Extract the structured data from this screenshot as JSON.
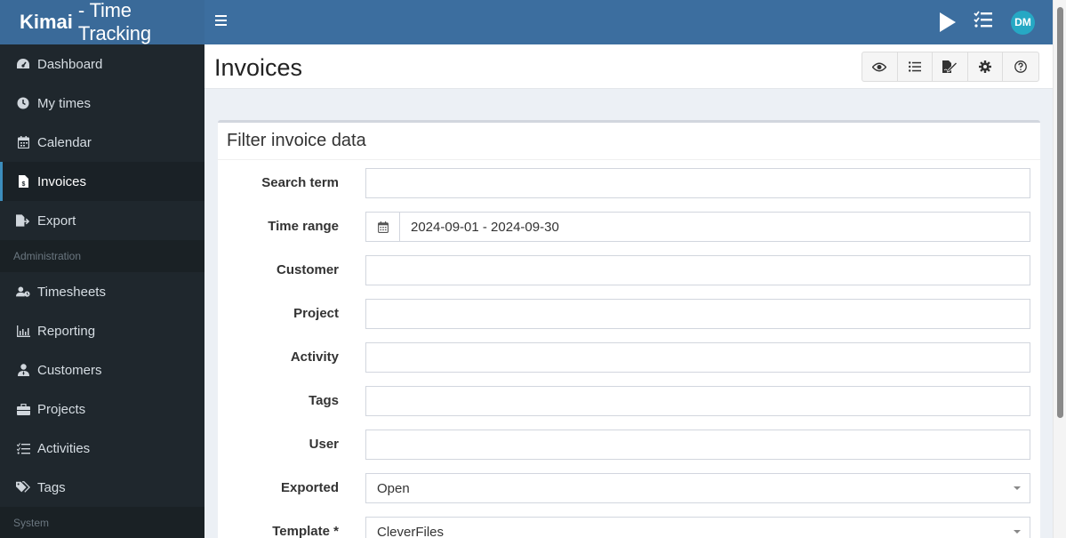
{
  "app": {
    "brand_bold": "Kimai",
    "brand_light": "- Time Tracking",
    "user_initials": "DM",
    "accent_color": "#3c6e9f",
    "avatar_color": "#26a8c4"
  },
  "sidebar": {
    "items": [
      {
        "label": "Dashboard",
        "icon": "dashboard-icon"
      },
      {
        "label": "My times",
        "icon": "clock-icon"
      },
      {
        "label": "Calendar",
        "icon": "calendar-icon"
      },
      {
        "label": "Invoices",
        "icon": "invoice-icon",
        "active": true
      },
      {
        "label": "Export",
        "icon": "export-icon"
      }
    ],
    "admin_header": "Administration",
    "admin_items": [
      {
        "label": "Timesheets",
        "icon": "user-clock-icon"
      },
      {
        "label": "Reporting",
        "icon": "chart-icon"
      },
      {
        "label": "Customers",
        "icon": "user-tie-icon"
      },
      {
        "label": "Projects",
        "icon": "briefcase-icon"
      },
      {
        "label": "Activities",
        "icon": "tasks-icon"
      },
      {
        "label": "Tags",
        "icon": "tags-icon"
      }
    ],
    "system_header": "System"
  },
  "page": {
    "title": "Invoices",
    "toolbar": [
      "eye-icon",
      "list-icon",
      "file-signature-icon",
      "gear-icon",
      "help-icon"
    ]
  },
  "filter": {
    "title": "Filter invoice data",
    "fields": {
      "search_term": {
        "label": "Search term",
        "value": ""
      },
      "time_range": {
        "label": "Time range",
        "value": "2024-09-01 - 2024-09-30"
      },
      "customer": {
        "label": "Customer",
        "value": ""
      },
      "project": {
        "label": "Project",
        "value": ""
      },
      "activity": {
        "label": "Activity",
        "value": ""
      },
      "tags": {
        "label": "Tags",
        "value": ""
      },
      "user": {
        "label": "User",
        "value": ""
      },
      "exported": {
        "label": "Exported",
        "value": "Open"
      },
      "template": {
        "label": "Template *",
        "value": "CleverFiles"
      }
    }
  }
}
